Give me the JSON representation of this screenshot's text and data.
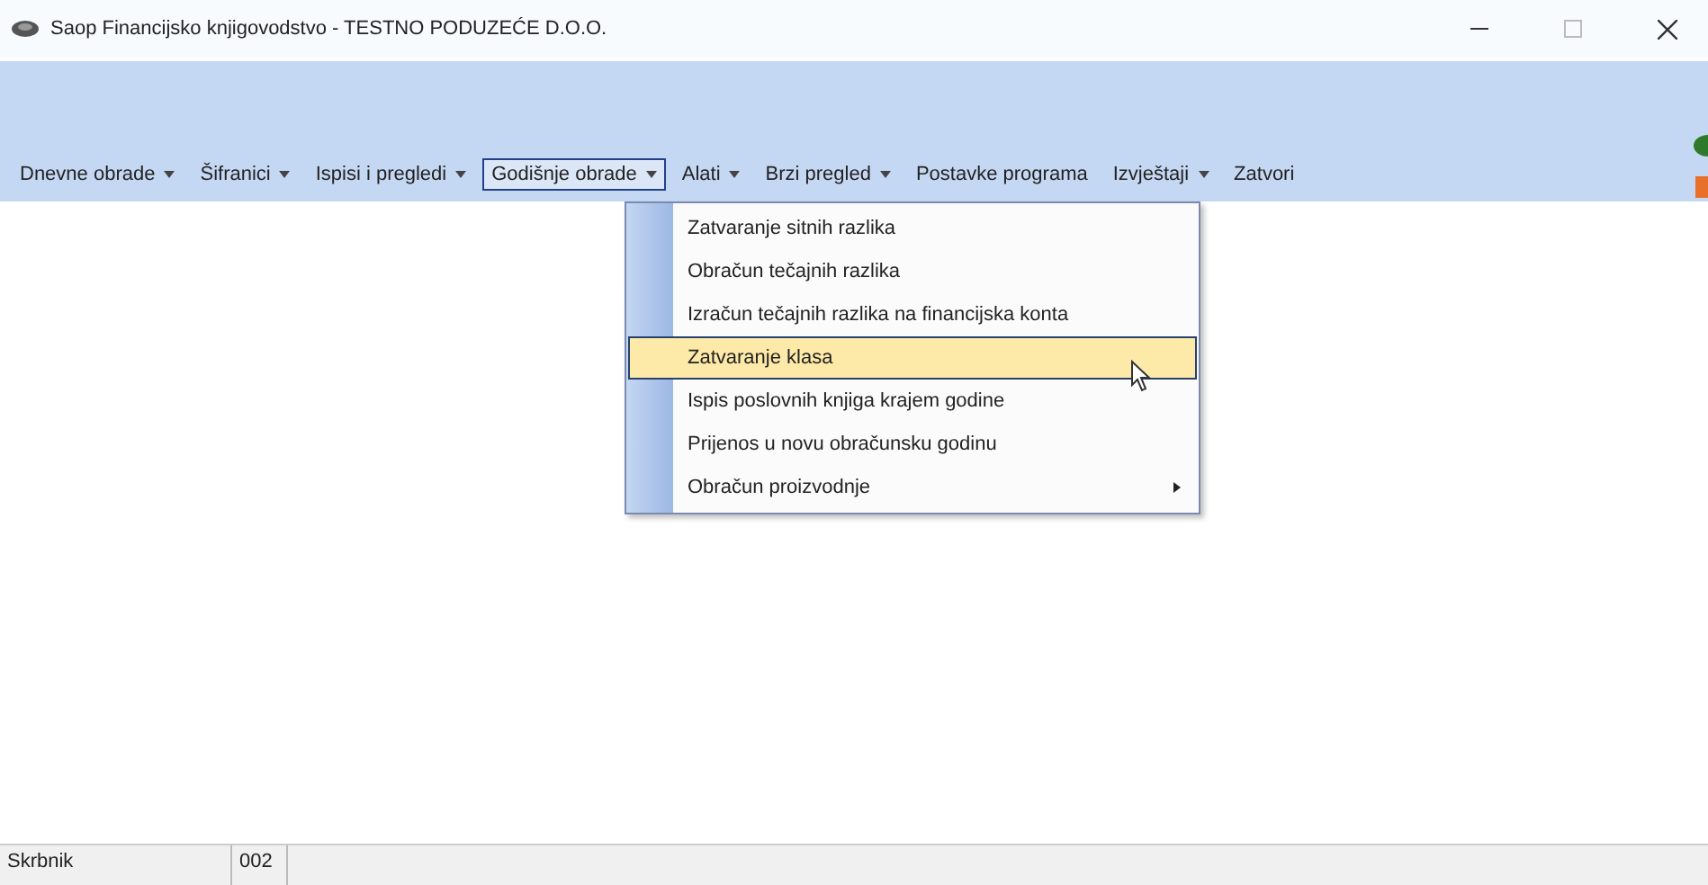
{
  "window": {
    "title": "Saop Financijsko knjigovodstvo - TESTNO PODUZEĆE D.O.O."
  },
  "menu_bar": [
    {
      "label": "Dnevne obrade",
      "dropdown": true,
      "selected": false
    },
    {
      "label": "Šifranici",
      "dropdown": true,
      "selected": false
    },
    {
      "label": "Ispisi i pregledi",
      "dropdown": true,
      "selected": false
    },
    {
      "label": "Godišnje obrade",
      "dropdown": true,
      "selected": true
    },
    {
      "label": "Alati",
      "dropdown": true,
      "selected": false
    },
    {
      "label": "Brzi pregled",
      "dropdown": true,
      "selected": false
    },
    {
      "label": "Postavke programa",
      "dropdown": false,
      "selected": false
    },
    {
      "label": "Izvještaji",
      "dropdown": true,
      "selected": false
    },
    {
      "label": "Zatvori",
      "dropdown": false,
      "selected": false
    }
  ],
  "dropdown_menu": [
    {
      "label": "Zatvaranje sitnih razlika",
      "selected": false,
      "submenu": false
    },
    {
      "label": "Obračun tečajnih razlika",
      "selected": false,
      "submenu": false
    },
    {
      "label": "Izračun tečajnih razlika na financijska konta",
      "selected": false,
      "submenu": false
    },
    {
      "label": "Zatvaranje klasa",
      "selected": true,
      "submenu": false
    },
    {
      "label": "Ispis poslovnih knjiga krajem godine",
      "selected": false,
      "submenu": false
    },
    {
      "label": "Prijenos u novu obračunsku godinu",
      "selected": false,
      "submenu": false
    },
    {
      "label": "Obračun proizvodnje",
      "selected": false,
      "submenu": true
    }
  ],
  "status_bar": [
    "Skrbnik",
    "002"
  ]
}
